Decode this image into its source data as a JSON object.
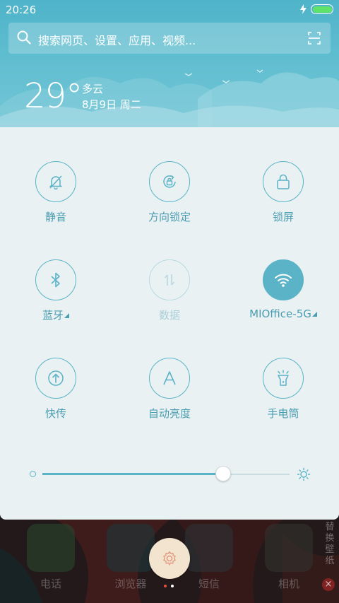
{
  "status_bar": {
    "time": "20:26",
    "battery_level": 1.0,
    "battery_color": "#5fe36a"
  },
  "search": {
    "placeholder": "搜索网页、设置、应用、视频...",
    "icon": "search-icon",
    "scan_icon": "scan-icon"
  },
  "weather": {
    "temperature": "29°",
    "condition": "多云",
    "date": "8月9日 周二"
  },
  "toggles": [
    {
      "label": "静音",
      "icon": "bell-off-icon",
      "state": "off"
    },
    {
      "label": "方向锁定",
      "icon": "rotation-lock-icon",
      "state": "off"
    },
    {
      "label": "锁屏",
      "icon": "lock-icon",
      "state": "off"
    },
    {
      "label": "蓝牙",
      "icon": "bluetooth-icon",
      "state": "off",
      "has_submenu": true
    },
    {
      "label": "数据",
      "icon": "mobile-data-icon",
      "state": "disabled"
    },
    {
      "label": "MIOffice-5G",
      "icon": "wifi-icon",
      "state": "on",
      "has_submenu": true
    },
    {
      "label": "快传",
      "icon": "quick-transfer-icon",
      "state": "off"
    },
    {
      "label": "自动亮度",
      "icon": "auto-brightness-icon",
      "state": "off"
    },
    {
      "label": "手电筒",
      "icon": "flashlight-icon",
      "state": "off"
    }
  ],
  "brightness": {
    "level": 0.73
  },
  "dock": {
    "apps": [
      {
        "label": "电话",
        "icon": "phone-icon"
      },
      {
        "label": "浏览器",
        "icon": "browser-icon"
      },
      {
        "label": "短信",
        "icon": "message-icon"
      },
      {
        "label": "相机",
        "icon": "camera-icon"
      }
    ],
    "side_text": "替换壁纸",
    "close_badge": "×",
    "settings_icon": "gear-icon",
    "page_count": 2,
    "current_page": 2
  },
  "colors": {
    "accent": "#5ab3c6",
    "label": "#4a9db1",
    "panel_bg": "#eaf1f3",
    "header_bg": "#63bfd1"
  }
}
